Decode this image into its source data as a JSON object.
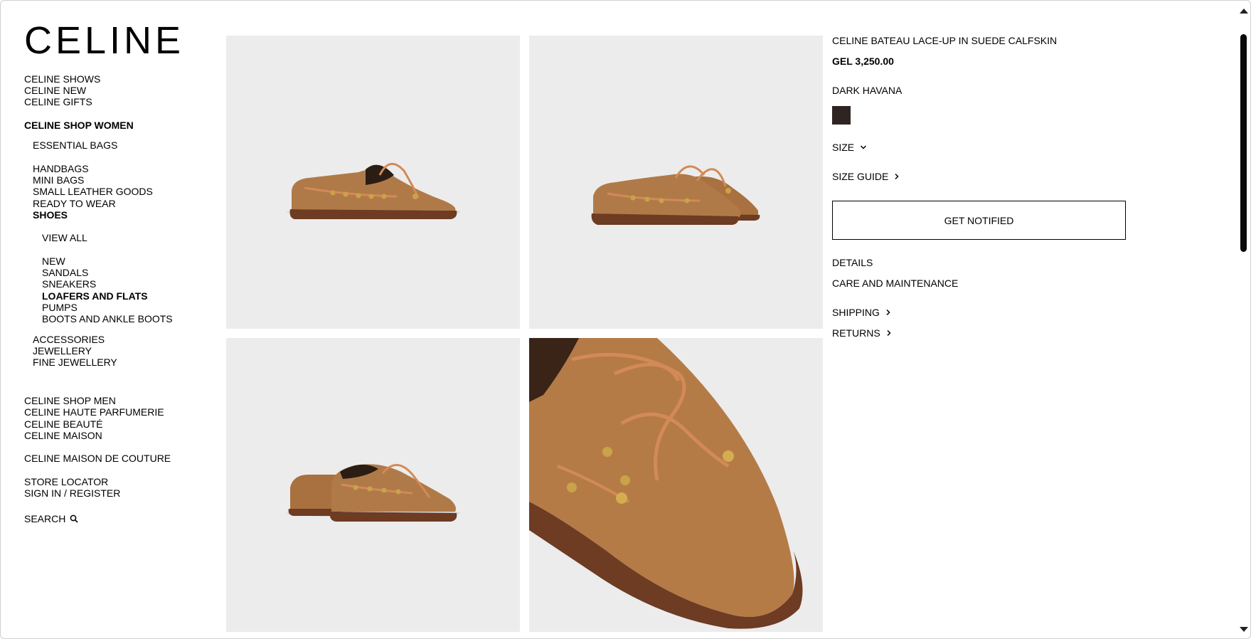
{
  "brand": {
    "logo_text": "CELINE"
  },
  "nav": {
    "celine_shows": "CELINE SHOWS",
    "celine_new": "CELINE NEW",
    "celine_gifts": "CELINE GIFTS",
    "shop_women": "CELINE SHOP WOMEN",
    "essential_bags": "ESSENTIAL BAGS",
    "handbags": "HANDBAGS",
    "mini_bags": "MINI BAGS",
    "small_leather_goods": "SMALL LEATHER GOODS",
    "ready_to_wear": "READY TO WEAR",
    "shoes": "SHOES",
    "view_all": "VIEW ALL",
    "new": "NEW",
    "sandals": "SANDALS",
    "sneakers": "SNEAKERS",
    "loafers_and_flats": "LOAFERS AND FLATS",
    "pumps": "PUMPS",
    "boots_and_ankle_boots": "BOOTS AND ANKLE BOOTS",
    "accessories": "ACCESSORIES",
    "jewellery": "JEWELLERY",
    "fine_jewellery": "FINE JEWELLERY",
    "shop_men": "CELINE SHOP MEN",
    "haute_parfumerie": "CELINE HAUTE PARFUMERIE",
    "beaute": "CELINE BEAUTÉ",
    "maison": "CELINE MAISON",
    "maison_de_couture": "CELINE MAISON DE COUTURE",
    "store_locator": "STORE LOCATOR",
    "sign_in_register": "SIGN IN / REGISTER",
    "search": "SEARCH"
  },
  "product": {
    "title": "CELINE BATEAU LACE-UP IN SUEDE CALFSKIN",
    "price": "GEL 3,250.00",
    "color_name": "DARK HAVANA",
    "color_swatch_hex": "#2e2522",
    "size_label": "SIZE",
    "size_guide_label": "SIZE GUIDE",
    "cta_label": "GET NOTIFIED",
    "details_label": "DETAILS",
    "care_label": "CARE AND MAINTENANCE",
    "shipping_label": "SHIPPING",
    "returns_label": "RETURNS"
  },
  "gallery": {
    "images": [
      "shoe-side-view",
      "pair-front-angle",
      "pair-back-angle",
      "toe-close-up"
    ]
  },
  "colors": {
    "tile_background": "#ececec",
    "suede": "#b07a48",
    "sole": "#6e3b23",
    "lace": "#d28a58",
    "gold": "#c9a34a"
  }
}
